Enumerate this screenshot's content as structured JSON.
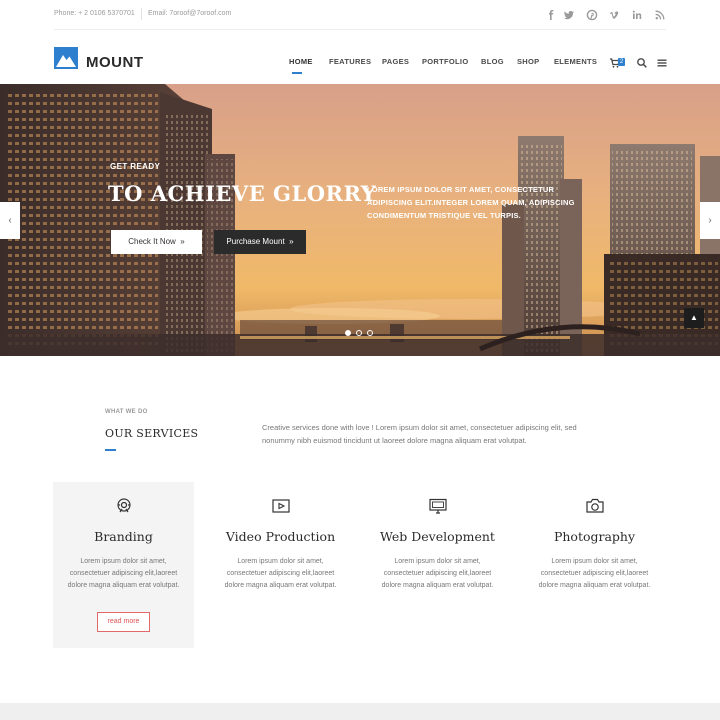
{
  "topbar": {
    "phone": "Phone: + 2 0106 5370701",
    "email": "Email: 7oroof@7oroof.com",
    "social": [
      "facebook-icon",
      "twitter-icon",
      "pinterest-icon",
      "vimeo-icon",
      "linkedin-icon",
      "rss-icon"
    ]
  },
  "header": {
    "logo": "MOUNT",
    "nav": [
      "HOME",
      "FEATURES",
      "PAGES",
      "PORTFOLIO",
      "BLOG",
      "SHOP",
      "ELEMENTS"
    ],
    "active_nav": "HOME",
    "cart_count": "2",
    "accent_color": "#2e7fce"
  },
  "hero": {
    "kicker": "GET READY",
    "title": "TO ACHIEVE GLORRY",
    "text": "LOREM IPSUM DOLOR SIT AMET, CONSECTETUR ADIPISCING ELIT.INTEGER LOREM QUAM, ADIPISCING CONDIMENTUM TRISTIQUE VEL TURPIS.",
    "primary_button": "Check It Now",
    "secondary_button": "Purchase Mount",
    "prev_arrow": "‹",
    "next_arrow": "›",
    "to_top": "▲"
  },
  "services": {
    "label": "WHAT WE DO",
    "heading": "OUR SERVICES",
    "intro": "Creative services done with love ! Lorem ipsum dolor sit amet, consectetuer adipiscing elit, sed nonummy nibh euismod tincidunt ut laoreet dolore magna aliquam erat volutpat.",
    "cards": [
      {
        "title": "Branding",
        "icon": "branding-icon",
        "text": "Lorem ipsum dolor sit amet, consectetuer adipiscing elit,laoreet dolore magna aliquam erat volutpat.",
        "button": "read more"
      },
      {
        "title": "Video Production",
        "icon": "video-icon",
        "text": "Lorem ipsum dolor sit amet, consectetuer adipiscing elit,laoreet dolore magna aliquam erat volutpat."
      },
      {
        "title": "Web Development",
        "icon": "monitor-icon",
        "text": "Lorem ipsum dolor sit amet, consectetuer adipiscing elit,laoreet dolore magna aliquam erat volutpat."
      },
      {
        "title": "Photography",
        "icon": "camera-icon",
        "text": "Lorem ipsum dolor sit amet, consectetuer adipiscing elit,laoreet dolore magna aliquam erat volutpat."
      }
    ],
    "button_color": "#e06a6a"
  }
}
